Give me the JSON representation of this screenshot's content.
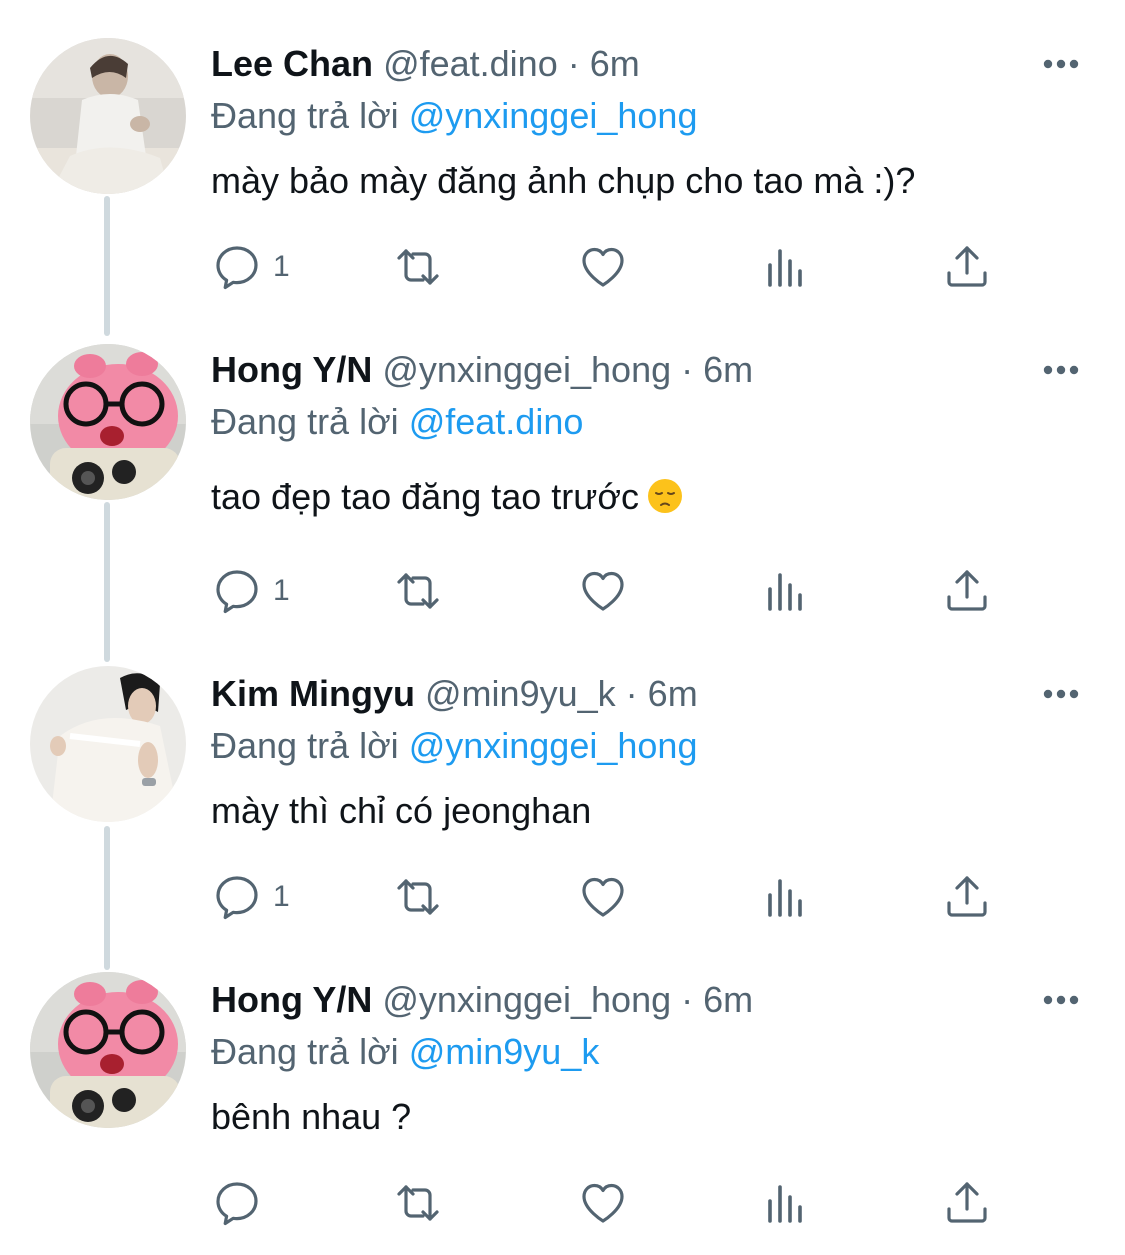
{
  "reply_prefix": "Đang trả lời",
  "tweets": [
    {
      "display_name": "Lee Chan",
      "handle": "@feat.dino",
      "separator": "·",
      "time": "6m",
      "reply_to": "@ynxinggei_hong",
      "text": "mày bảo mày đăng ảnh chụp cho tao mà :)?",
      "reply_count": "1",
      "avatar": "photo-person-white-tee"
    },
    {
      "display_name": "Hong Y/N",
      "handle": "@ynxinggei_hong",
      "separator": "·",
      "time": "6m",
      "reply_to": "@feat.dino",
      "text": "tao đẹp tao đăng tao trước",
      "emoji": "pensive-face",
      "reply_count": "1",
      "avatar": "photo-pink-plush-glasses"
    },
    {
      "display_name": "Kim Mingyu",
      "handle": "@min9yu_k",
      "separator": "·",
      "time": "6m",
      "reply_to": "@ynxinggei_hong",
      "text": "mày thì chỉ có jeonghan",
      "reply_count": "1",
      "avatar": "photo-person-white-shirt"
    },
    {
      "display_name": "Hong Y/N",
      "handle": "@ynxinggei_hong",
      "separator": "·",
      "time": "6m",
      "reply_to": "@min9yu_k",
      "text": "bênh nhau ?",
      "reply_count": "",
      "avatar": "photo-pink-plush-glasses"
    }
  ],
  "colors": {
    "text": "#0f1419",
    "secondary": "#536471",
    "link": "#1d9bf0",
    "thread_line": "#cfd9de"
  }
}
